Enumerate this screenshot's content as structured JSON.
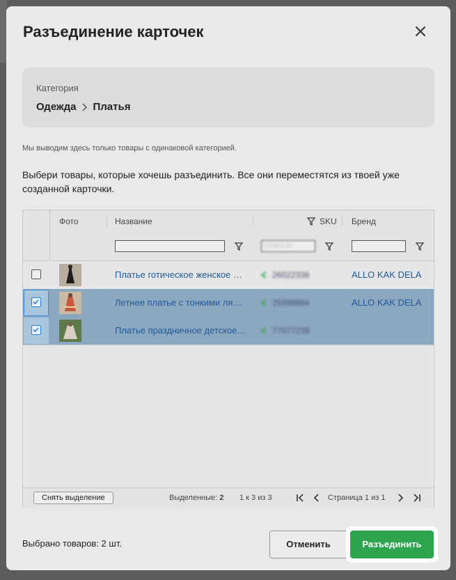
{
  "modal": {
    "title": "Разъединение карточек",
    "category": {
      "label": "Категория",
      "path": [
        "Одежда",
        "Платья"
      ]
    },
    "note": "Мы выводим здесь только товары с одинаковой категорией.",
    "instruction": "Выбери товары, которые хочешь разъединить. Все они переместятся из твоей уже созданной карточки."
  },
  "grid": {
    "columns": {
      "photo": "Фото",
      "name": "Название",
      "sku": "SKU",
      "brand": "Бренд"
    },
    "filters": {
      "sku_value": "25980130"
    },
    "rows": [
      {
        "name": "Платье готическое женское длинное",
        "sku": "26022336",
        "brand": "ALLO KAK DELA",
        "selected": false
      },
      {
        "name": "Летнее платье с тонкими лямками",
        "sku": "25999894",
        "brand": "ALLO KAK DELA",
        "selected": true
      },
      {
        "name": "Платье праздничное детское нарядное",
        "sku": "77077239",
        "brand": "",
        "selected": true
      }
    ],
    "footer": {
      "unselect_label": "Снять выделение",
      "selected_label": "Выделенные: ",
      "selected_value": "2",
      "range": "1 к 3 из 3",
      "page": "Страница 1 из 1"
    }
  },
  "bottom": {
    "selected_text": "Выбрано товаров: 2 шт.",
    "cancel_label": "Отменить",
    "confirm_label": "Разъединить"
  },
  "colors": {
    "accent_green": "#2ea44f",
    "link_blue": "#1e5a9a",
    "selection_blue": "#8ca8c0"
  }
}
